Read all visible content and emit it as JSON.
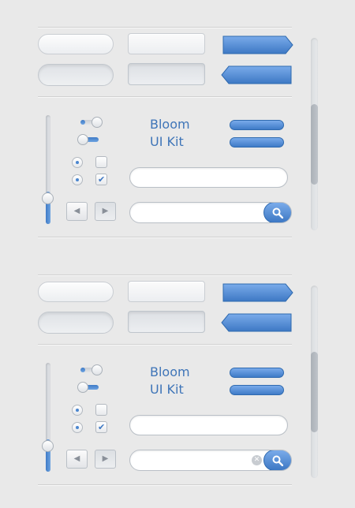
{
  "brand": {
    "line1": "Bloom",
    "line2": "UI Kit"
  },
  "colors": {
    "accent": "#4a86cf",
    "accent_dark": "#2f6aaf",
    "background": "#e9e9e9",
    "text_accent": "#3f75b8"
  },
  "panels": [
    {
      "id": "panel-1",
      "slider_value": 0.3,
      "search_has_clear": false,
      "scrollbar_value": 0.42
    },
    {
      "id": "panel-2",
      "slider_value": 0.3,
      "search_has_clear": true,
      "scrollbar_value": 0.42
    }
  ],
  "icons": {
    "prev": "triangle-left-icon",
    "next": "triangle-right-icon",
    "search": "magnifier-icon",
    "clear": "clear-x-icon",
    "check": "checkmark-icon"
  },
  "glyphs": {
    "prev": "◀",
    "next": "▶",
    "check": "✔",
    "clear": "✕"
  },
  "textfield": {
    "value": "",
    "placeholder": ""
  },
  "searchfield": {
    "value": "",
    "placeholder": ""
  }
}
